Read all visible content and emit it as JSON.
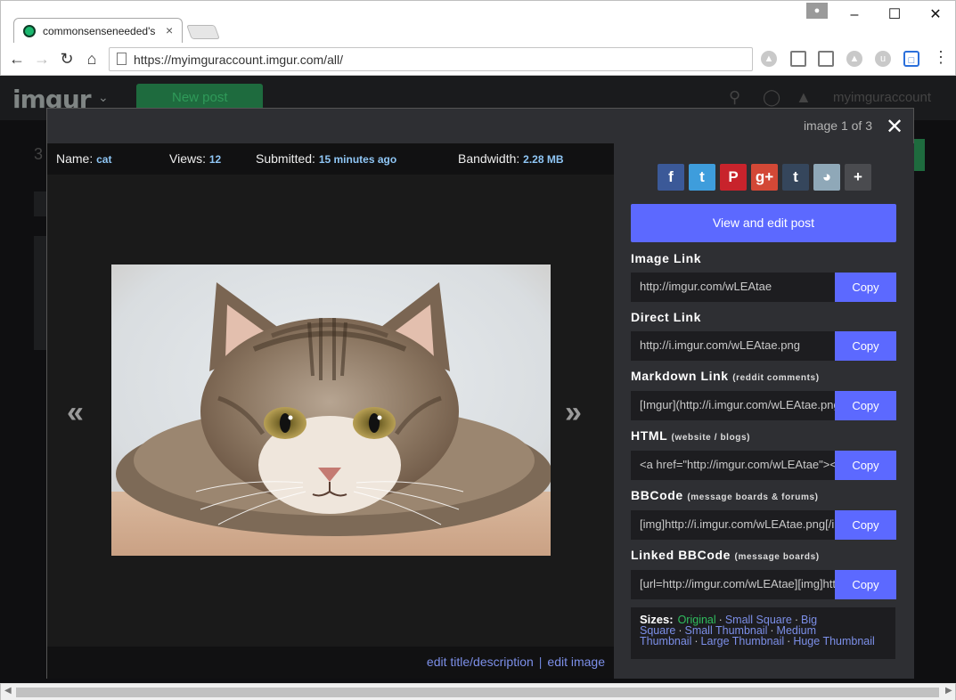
{
  "browser": {
    "tab_title": "commonsenseneeded's",
    "tab_close": "×",
    "profile_icon": "person-icon",
    "window": {
      "minimize": "–",
      "maximize": "☐",
      "close": "✕"
    },
    "url": "https://myimguraccount.imgur.com/all/",
    "extensions": [
      "drive-icon",
      "cast-icon",
      "screen-icon",
      "pin-icon",
      "shield-icon",
      "tab-icon"
    ]
  },
  "site": {
    "logo": "imgur",
    "new_post": "New post",
    "username": "myimguraccount",
    "bg_count": "3"
  },
  "modal": {
    "counter": "image 1 of 3",
    "close": "✕",
    "info": {
      "name_label": "Name:",
      "name_value": "cat",
      "views_label": "Views:",
      "views_value": "12",
      "submitted_label": "Submitted:",
      "submitted_value": "15 minutes ago",
      "bandwidth_label": "Bandwidth:",
      "bandwidth_value": "2.28 MB"
    },
    "prev": "«",
    "next": "»",
    "edit_title": "edit title/description",
    "sep": "|",
    "edit_image": "edit image",
    "shares": [
      {
        "name": "facebook-icon",
        "glyph": "f",
        "color": "#3b5998"
      },
      {
        "name": "twitter-icon",
        "glyph": "t",
        "color": "#3e9ddc"
      },
      {
        "name": "pinterest-icon",
        "glyph": "P",
        "color": "#c8232c"
      },
      {
        "name": "googleplus-icon",
        "glyph": "g+",
        "color": "#d34836"
      },
      {
        "name": "tumblr-icon",
        "glyph": "t",
        "color": "#35465c"
      },
      {
        "name": "reddit-icon",
        "glyph": "◕",
        "color": "#8fa8b8"
      },
      {
        "name": "more-icon",
        "glyph": "+",
        "color": "#4a4b4f"
      }
    ],
    "view_edit": "View and edit post",
    "copy": "Copy",
    "fields": {
      "image_link": {
        "label": "Image Link",
        "hint": "",
        "value": "http://imgur.com/wLEAtae"
      },
      "direct_link": {
        "label": "Direct Link",
        "hint": "",
        "value": "http://i.imgur.com/wLEAtae.png"
      },
      "markdown": {
        "label": "Markdown Link",
        "hint": "(reddit comments)",
        "value": "[Imgur](http://i.imgur.com/wLEAtae.png)"
      },
      "html": {
        "label": "HTML",
        "hint": "(website / blogs)",
        "value": "<a href=\"http://imgur.com/wLEAtae\"><img src=\"http://i.imgur.com/wLEAtae.png\" /></a>"
      },
      "bbcode": {
        "label": "BBCode",
        "hint": "(message boards & forums)",
        "value": "[img]http://i.imgur.com/wLEAtae.png[/img]"
      },
      "linked_bbcode": {
        "label": "Linked BBCode",
        "hint": "(message boards)",
        "value": "[url=http://imgur.com/wLEAtae][img]http://i.imgur.com/wLEAtae.png[/img][/url]"
      }
    },
    "sizes": {
      "label": "Sizes:",
      "original": "Original",
      "small_square": "Small Square",
      "big_square": "Big Square",
      "small_thumb": "Small Thumbnail",
      "medium_thumb": "Medium Thumbnail",
      "large_thumb": "Large Thumbnail",
      "huge_thumb": "Huge Thumbnail"
    }
  },
  "colors": {
    "accent": "#5c69ff",
    "original_green": "#2fbd5e",
    "link_blue": "#7c8fe8",
    "info_blue": "#8fc6f5"
  }
}
